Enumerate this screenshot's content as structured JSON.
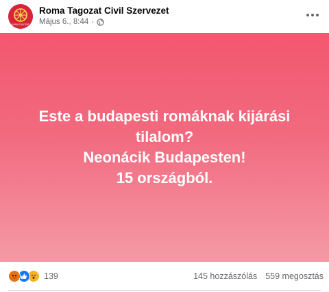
{
  "header": {
    "page_name": "Roma Tagozat Civil Szervezet",
    "date": "Május 6., 8:44",
    "separator": "·",
    "avatar_caption": "ROMA TAGOZAT"
  },
  "post": {
    "lines": [
      "Este a budapesti romáknak kijárási",
      "tilalom?",
      "Neonácik Budapesten!",
      "15 országból."
    ],
    "background_colors": [
      "#f2576f",
      "#f49aa6"
    ]
  },
  "footer": {
    "reaction_count": "139",
    "comments": "145 hozzászólás",
    "shares": "559 megosztás",
    "reaction_icons": [
      "angry-icon",
      "like-icon",
      "wow-icon"
    ]
  }
}
